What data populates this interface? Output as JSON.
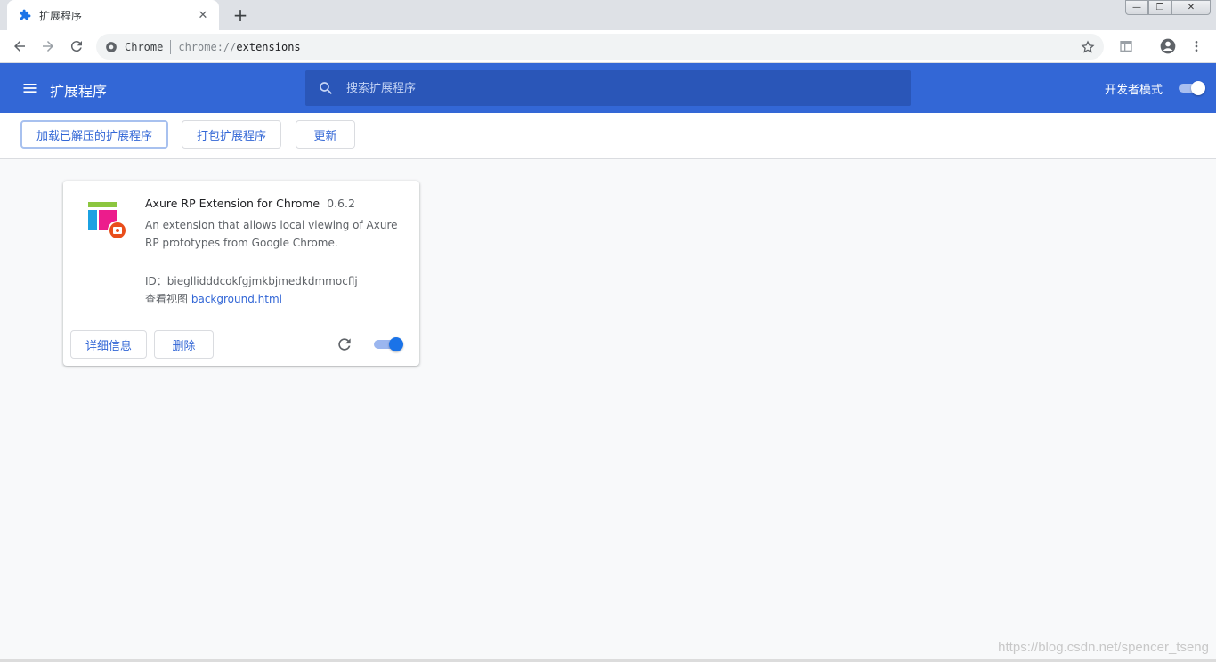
{
  "tab": {
    "title": "扩展程序",
    "favicon": "puzzle-icon"
  },
  "toolbar": {
    "site_label": "Chrome",
    "url_scheme": "chrome://",
    "url_path": "extensions"
  },
  "header": {
    "title": "扩展程序",
    "search_placeholder": "搜索扩展程序",
    "dev_mode_label": "开发者模式",
    "dev_mode_on": true,
    "color": "#3367d6"
  },
  "actions": {
    "load_unpacked": "加载已解压的扩展程序",
    "pack": "打包扩展程序",
    "update": "更新"
  },
  "extension": {
    "name": "Axure RP Extension for Chrome",
    "version": "0.6.2",
    "description": "An extension that allows local viewing of Axure RP prototypes from Google Chrome.",
    "id_line": "ID：biegllidddcokfgjmkbjmedkdmmocflj",
    "views_label": "查看视图",
    "views_link": "background.html",
    "details_button": "详细信息",
    "remove_button": "删除",
    "enabled": true
  },
  "watermark": "https://blog.csdn.net/spencer_tseng"
}
